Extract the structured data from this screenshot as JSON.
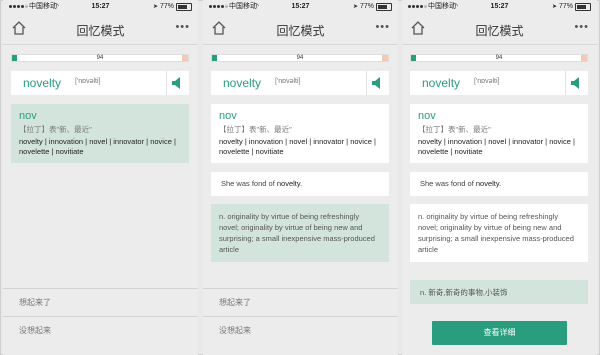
{
  "status": {
    "carrier": "中国移动",
    "time": "15:27",
    "battery": "77%",
    "battery_level": 0.77
  },
  "nav": {
    "title": "回忆模式",
    "more": "•••"
  },
  "progress": {
    "label": "94",
    "fill_fraction": 0.03
  },
  "word": {
    "text": "novelty",
    "phonetic": "['nɒvəlti]"
  },
  "root": {
    "root": "nov",
    "origin": "【拉丁】表\"新、最近\"",
    "family": "novelty | innovation | novel | innovator | novice | novelette | novitiate"
  },
  "example": {
    "before": "She was fond of ",
    "highlight": "novelty",
    "after": "."
  },
  "definition": "n. originality by virtue of being refreshingly novel; originality by virtue of being new and surprising; a small inexpensive mass-produced article",
  "chinese": "n. 新奇,新奇的事物,小装饰",
  "buttons": {
    "remembered": "想起来了",
    "not_remembered": "没想起来",
    "view_details": "查看详细"
  },
  "colors": {
    "accent": "#2a9d7e",
    "card_green": "#d3e4dd",
    "progress_end": "#f2c9b3"
  },
  "icons": {
    "home": "home-icon",
    "speaker": "speaker-icon",
    "signal": "signal-icon",
    "wifi": "wifi-icon",
    "location": "location-icon",
    "battery": "battery-icon"
  }
}
